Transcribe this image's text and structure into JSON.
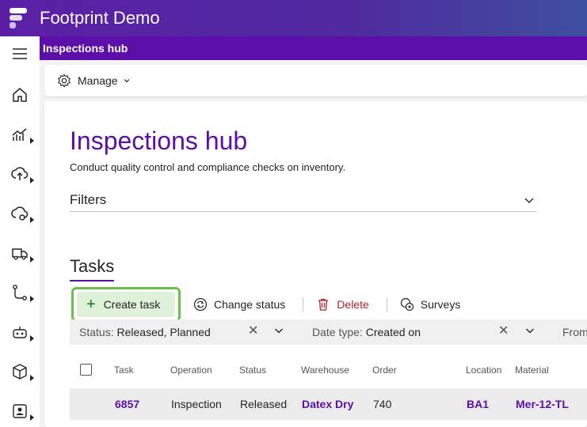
{
  "app": {
    "title": "Footprint Demo"
  },
  "sidebar": {
    "items": [
      {
        "icon": "menu-icon"
      },
      {
        "icon": "home-icon"
      },
      {
        "icon": "analytics-icon"
      },
      {
        "icon": "inbound-icon"
      },
      {
        "icon": "outbound-icon"
      },
      {
        "icon": "transport-icon"
      },
      {
        "icon": "workflow-icon"
      },
      {
        "icon": "robot-icon"
      },
      {
        "icon": "inventory-icon"
      },
      {
        "icon": "contact-card-icon"
      }
    ]
  },
  "header": {
    "page_label": "Inspections hub"
  },
  "manage": {
    "label": "Manage"
  },
  "hub": {
    "title": "Inspections hub",
    "subtitle": "Conduct quality control and compliance checks on inventory."
  },
  "filters": {
    "label": "Filters"
  },
  "tasks": {
    "title": "Tasks",
    "toolbar": {
      "create": "Create task",
      "change_status": "Change status",
      "delete": "Delete",
      "surveys": "Surveys"
    },
    "filter_row": {
      "status_label": "Status:",
      "status_value": "Released, Planned",
      "date_type_label": "Date type:",
      "date_type_value": "Created on",
      "from_label": "From"
    },
    "columns": [
      "Task",
      "Operation",
      "Status",
      "Warehouse",
      "Order",
      "Location",
      "Material"
    ],
    "rows": [
      {
        "task": "6857",
        "operation": "Inspection",
        "status": "Released",
        "warehouse": "Datex Dry",
        "order": "740",
        "location": "BA1",
        "material": "Mer-12-TL"
      }
    ]
  },
  "colors": {
    "brand": "#5b0fa8",
    "highlight": "#6cc04a",
    "danger": "#a4262c"
  }
}
